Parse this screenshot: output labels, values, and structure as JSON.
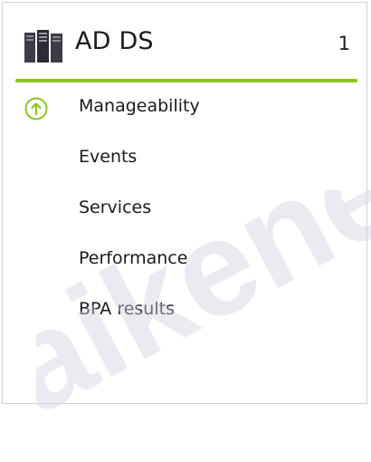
{
  "tile": {
    "title": "AD DS",
    "count": "1",
    "icon": "server-role-icon",
    "accent_color": "#8fc31f",
    "status_icon": "up-arrow-circle-icon",
    "status_color": "#8fc31f",
    "items": [
      {
        "label": "Manageability",
        "status": "ok"
      },
      {
        "label": "Events"
      },
      {
        "label": "Services"
      },
      {
        "label": "Performance"
      },
      {
        "label": "BPA results"
      }
    ]
  },
  "watermark": {
    "text": "aikene"
  }
}
